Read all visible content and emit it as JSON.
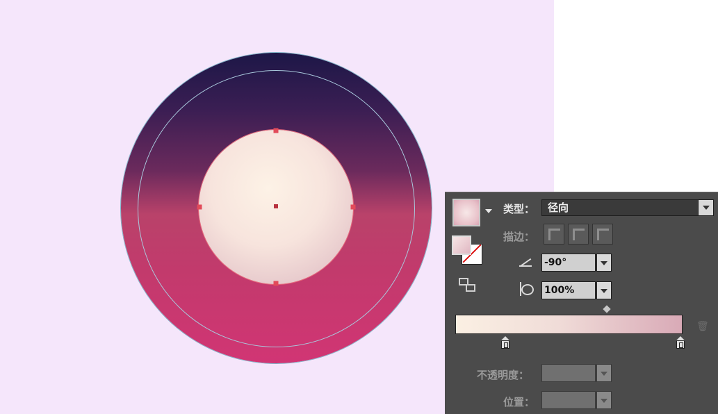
{
  "panel": {
    "type_label": "类型：",
    "type_value": "径向",
    "stroke_label": "描边：",
    "angle_value": "-90°",
    "aspect_value": "100%",
    "opacity_label": "不透明度：",
    "location_label": "位置："
  },
  "gradient": {
    "type": "radial",
    "stops": [
      "#fbf0e3",
      "#d9aab7"
    ]
  },
  "icons": {
    "fill_swatch": "gradient-fill-swatch-icon",
    "stroke_swatch": "fill-stroke-swatch-icon",
    "swap": "swap-fill-stroke-icon",
    "angle": "angle-icon",
    "aspect": "aspect-ratio-icon",
    "trash": "delete-stop-icon"
  }
}
